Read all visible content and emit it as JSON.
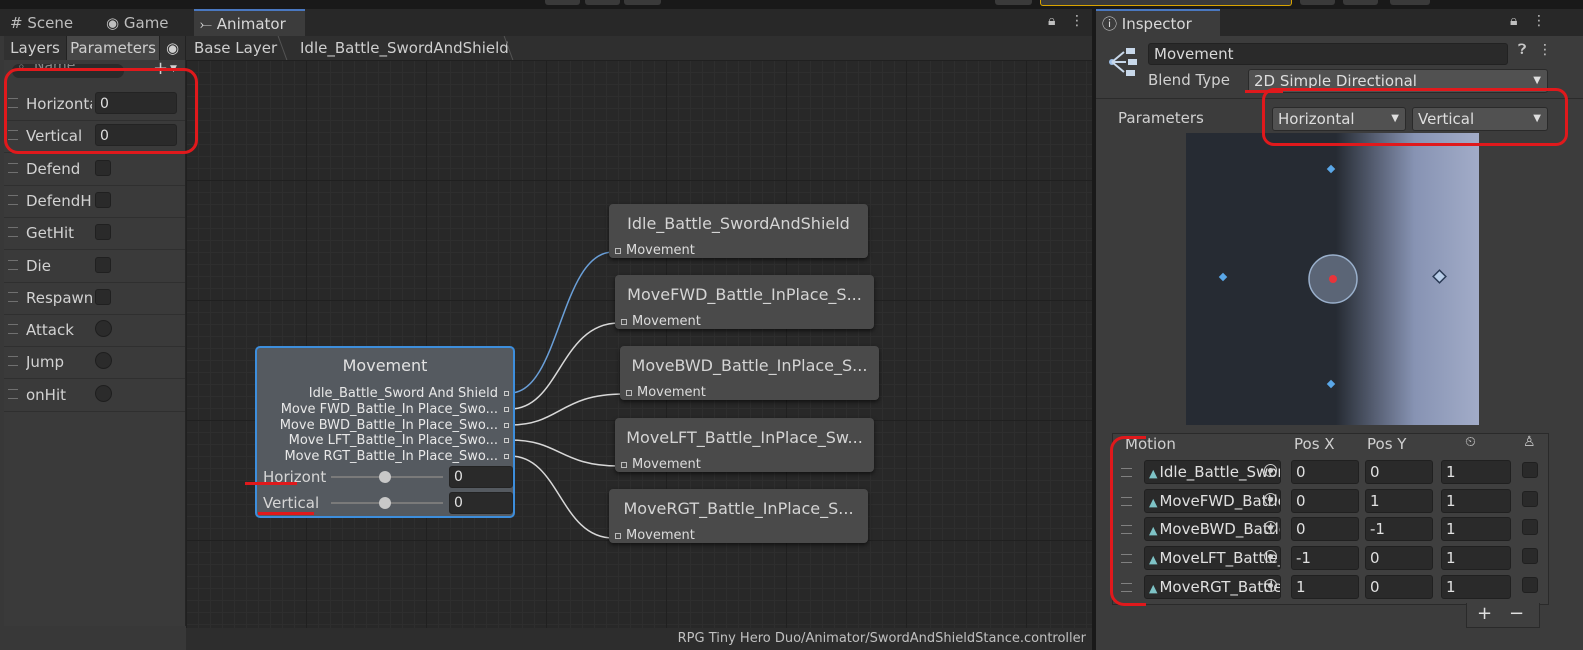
{
  "tabs_left": [
    {
      "label": "Scene",
      "icon": "grid-icon"
    },
    {
      "label": "Game",
      "icon": "gamepad-icon"
    },
    {
      "label": "Animator",
      "icon": "animator-icon"
    }
  ],
  "inspector_tab": {
    "label": "Inspector",
    "icon": "info-icon"
  },
  "animator": {
    "subtabs": [
      "Layers",
      "Parameters"
    ],
    "search_placeholder": "Name",
    "breadcrumb": [
      "Base Layer",
      "Idle_Battle_SwordAndShield"
    ],
    "status_path": "RPG Tiny Hero Duo/Animator/SwordAndShieldStance.controller",
    "parameters": [
      {
        "name": "Horizontal",
        "type": "float",
        "value": "0"
      },
      {
        "name": "Vertical",
        "type": "float",
        "value": "0"
      },
      {
        "name": "Defend",
        "type": "bool"
      },
      {
        "name": "DefendHit",
        "type": "bool"
      },
      {
        "name": "GetHit",
        "type": "bool"
      },
      {
        "name": "Die",
        "type": "bool"
      },
      {
        "name": "Respawn",
        "type": "bool"
      },
      {
        "name": "Attack",
        "type": "trigger"
      },
      {
        "name": "Jump",
        "type": "trigger"
      },
      {
        "name": "onHit",
        "type": "trigger"
      }
    ],
    "blend_node": {
      "title": "Movement",
      "motions": [
        "Idle_Battle_Sword And Shield",
        "Move FWD_Battle_In Place_Swo...",
        "Move BWD_Battle_In Place_Swo...",
        "Move LFT_Battle_In Place_Swo...",
        "Move RGT_Battle_In Place_Swo..."
      ],
      "sliders": [
        {
          "label": "Horizontal",
          "value": "0"
        },
        {
          "label": "Vertical",
          "value": "0"
        }
      ]
    },
    "clip_nodes": [
      {
        "title": "Idle_Battle_SwordAndShield",
        "port": "Movement"
      },
      {
        "title": "MoveFWD_Battle_InPlace_S...",
        "port": "Movement"
      },
      {
        "title": "MoveBWD_Battle_InPlace_S...",
        "port": "Movement"
      },
      {
        "title": "MoveLFT_Battle_InPlace_Sw...",
        "port": "Movement"
      },
      {
        "title": "MoveRGT_Battle_InPlace_S...",
        "port": "Movement"
      }
    ]
  },
  "inspector": {
    "name": "Movement",
    "blend_type_label": "Blend Type",
    "blend_type": "2D Simple Directional",
    "parameters_label": "Parameters",
    "param_x": "Horizontal",
    "param_y": "Vertical",
    "table_headers": {
      "motion": "Motion",
      "pos_x": "Pos X",
      "pos_y": "Pos Y"
    },
    "motions": [
      {
        "clip": "Idle_Battle_SwordAndShield",
        "pos_x": "0",
        "pos_y": "0",
        "speed": "1"
      },
      {
        "clip": "MoveFWD_Battle_InPlace_SwordAndShield",
        "pos_x": "0",
        "pos_y": "1",
        "speed": "1"
      },
      {
        "clip": "MoveBWD_Battle_InPlace_SwordAndShield",
        "pos_x": "0",
        "pos_y": "-1",
        "speed": "1"
      },
      {
        "clip": "MoveLFT_Battle_InPlace_SwordAndShield",
        "pos_x": "-1",
        "pos_y": "0",
        "speed": "1"
      },
      {
        "clip": "MoveRGT_Battle_InPlace_SwordAndShield",
        "pos_x": "1",
        "pos_y": "0",
        "speed": "1"
      }
    ],
    "add_label": "+",
    "remove_label": "−"
  },
  "colors": {
    "selection": "#3d8edc",
    "annotation": "#e0191c",
    "graph_bg": "#282828"
  }
}
